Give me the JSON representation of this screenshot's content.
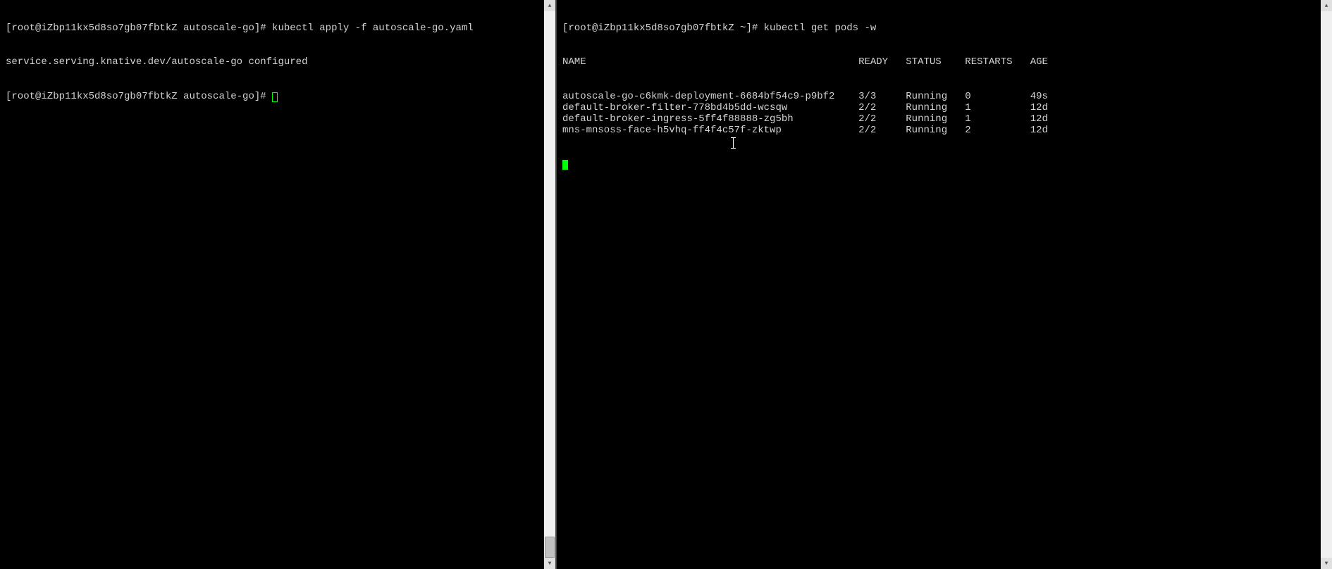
{
  "leftPane": {
    "line1": "[root@iZbp11kx5d8so7gb07fbtkZ autoscale-go]# kubectl apply -f autoscale-go.yaml",
    "line2": "service.serving.knative.dev/autoscale-go configured",
    "line3_prompt": "[root@iZbp11kx5d8so7gb07fbtkZ autoscale-go]# "
  },
  "rightPane": {
    "promptLine": "[root@iZbp11kx5d8so7gb07fbtkZ ~]# kubectl get pods -w",
    "headers": {
      "name": "NAME",
      "ready": "READY",
      "status": "STATUS",
      "restarts": "RESTARTS",
      "age": "AGE"
    },
    "rows": [
      {
        "name": "autoscale-go-c6kmk-deployment-6684bf54c9-p9bf2",
        "ready": "3/3",
        "status": "Running",
        "restarts": "0",
        "age": "49s"
      },
      {
        "name": "default-broker-filter-778bd4b5dd-wcsqw",
        "ready": "2/2",
        "status": "Running",
        "restarts": "1",
        "age": "12d"
      },
      {
        "name": "default-broker-ingress-5ff4f88888-zg5bh",
        "ready": "2/2",
        "status": "Running",
        "restarts": "1",
        "age": "12d"
      },
      {
        "name": "mns-mnsoss-face-h5vhq-ff4f4c57f-zktwp",
        "ready": "2/2",
        "status": "Running",
        "restarts": "2",
        "age": "12d"
      }
    ]
  }
}
